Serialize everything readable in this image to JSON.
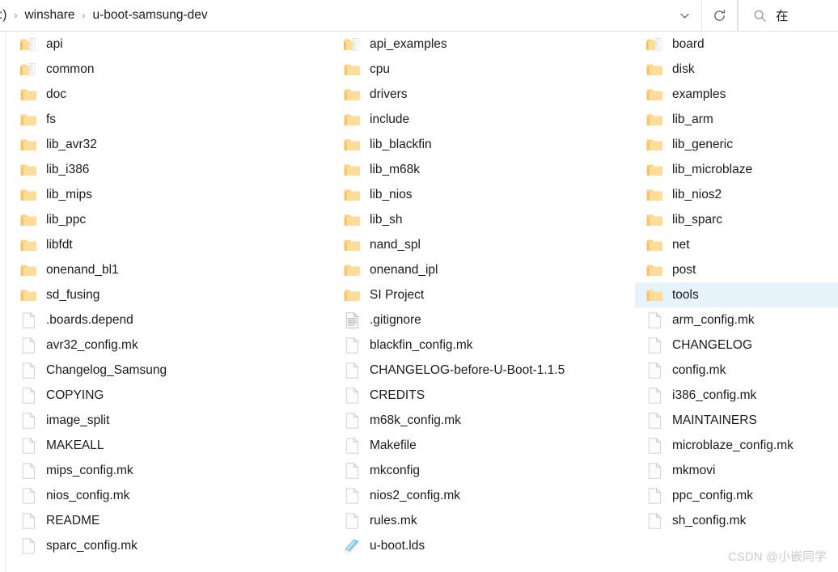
{
  "window": {
    "type": "file-explorer"
  },
  "addressbar": {
    "breadcrumbs": [
      {
        "label": ":)",
        "clipped": true
      },
      {
        "label": "winshare",
        "clipped": false
      },
      {
        "label": "u-boot-samsung-dev",
        "clipped": false
      }
    ],
    "separator": "›",
    "dropdown_icon": "chevron-down-icon",
    "refresh_icon": "refresh-icon",
    "search": {
      "icon": "search-icon",
      "placeholder": "在"
    }
  },
  "columns": [
    {
      "name": "column-1",
      "items": [
        {
          "name": "api",
          "icon": "shared-folder-icon"
        },
        {
          "name": "common",
          "icon": "shared-folder-icon"
        },
        {
          "name": "doc",
          "icon": "folder-icon"
        },
        {
          "name": "fs",
          "icon": "folder-icon"
        },
        {
          "name": "lib_avr32",
          "icon": "folder-icon"
        },
        {
          "name": "lib_i386",
          "icon": "folder-icon"
        },
        {
          "name": "lib_mips",
          "icon": "folder-icon"
        },
        {
          "name": "lib_ppc",
          "icon": "folder-icon"
        },
        {
          "name": "libfdt",
          "icon": "folder-icon"
        },
        {
          "name": "onenand_bl1",
          "icon": "folder-icon"
        },
        {
          "name": "sd_fusing",
          "icon": "folder-icon"
        },
        {
          "name": ".boards.depend",
          "icon": "file-icon"
        },
        {
          "name": "avr32_config.mk",
          "icon": "file-icon"
        },
        {
          "name": "Changelog_Samsung",
          "icon": "file-icon"
        },
        {
          "name": "COPYING",
          "icon": "file-icon"
        },
        {
          "name": "image_split",
          "icon": "file-icon"
        },
        {
          "name": "MAKEALL",
          "icon": "file-icon"
        },
        {
          "name": "mips_config.mk",
          "icon": "file-icon"
        },
        {
          "name": "nios_config.mk",
          "icon": "file-icon"
        },
        {
          "name": "README",
          "icon": "file-icon"
        },
        {
          "name": "sparc_config.mk",
          "icon": "file-icon"
        }
      ]
    },
    {
      "name": "column-2",
      "items": [
        {
          "name": "api_examples",
          "icon": "shared-folder-icon"
        },
        {
          "name": "cpu",
          "icon": "folder-icon"
        },
        {
          "name": "drivers",
          "icon": "folder-icon"
        },
        {
          "name": "include",
          "icon": "folder-icon"
        },
        {
          "name": "lib_blackfin",
          "icon": "folder-icon"
        },
        {
          "name": "lib_m68k",
          "icon": "folder-icon"
        },
        {
          "name": "lib_nios",
          "icon": "folder-icon"
        },
        {
          "name": "lib_sh",
          "icon": "folder-icon"
        },
        {
          "name": "nand_spl",
          "icon": "folder-icon"
        },
        {
          "name": "onenand_ipl",
          "icon": "folder-icon"
        },
        {
          "name": "SI Project",
          "icon": "folder-icon"
        },
        {
          "name": ".gitignore",
          "icon": "text-document-icon"
        },
        {
          "name": "blackfin_config.mk",
          "icon": "file-icon"
        },
        {
          "name": "CHANGELOG-before-U-Boot-1.1.5",
          "icon": "file-icon"
        },
        {
          "name": "CREDITS",
          "icon": "file-icon"
        },
        {
          "name": "m68k_config.mk",
          "icon": "file-icon"
        },
        {
          "name": "Makefile",
          "icon": "file-icon"
        },
        {
          "name": "mkconfig",
          "icon": "file-icon"
        },
        {
          "name": "nios2_config.mk",
          "icon": "file-icon"
        },
        {
          "name": "rules.mk",
          "icon": "file-icon"
        },
        {
          "name": "u-boot.lds",
          "icon": "lds-document-icon"
        }
      ]
    },
    {
      "name": "column-3",
      "items": [
        {
          "name": "board",
          "icon": "shared-folder-icon"
        },
        {
          "name": "disk",
          "icon": "folder-icon"
        },
        {
          "name": "examples",
          "icon": "folder-icon"
        },
        {
          "name": "lib_arm",
          "icon": "folder-icon"
        },
        {
          "name": "lib_generic",
          "icon": "folder-icon"
        },
        {
          "name": "lib_microblaze",
          "icon": "folder-icon"
        },
        {
          "name": "lib_nios2",
          "icon": "folder-icon"
        },
        {
          "name": "lib_sparc",
          "icon": "folder-icon"
        },
        {
          "name": "net",
          "icon": "folder-icon"
        },
        {
          "name": "post",
          "icon": "folder-icon"
        },
        {
          "name": "tools",
          "icon": "folder-icon",
          "selected": true
        },
        {
          "name": "arm_config.mk",
          "icon": "file-icon"
        },
        {
          "name": "CHANGELOG",
          "icon": "file-icon"
        },
        {
          "name": "config.mk",
          "icon": "file-icon"
        },
        {
          "name": "i386_config.mk",
          "icon": "file-icon"
        },
        {
          "name": "MAINTAINERS",
          "icon": "file-icon"
        },
        {
          "name": "microblaze_config.mk",
          "icon": "file-icon"
        },
        {
          "name": "mkmovi",
          "icon": "file-icon"
        },
        {
          "name": "ppc_config.mk",
          "icon": "file-icon"
        },
        {
          "name": "sh_config.mk",
          "icon": "file-icon"
        }
      ]
    }
  ],
  "watermark": {
    "text": "CSDN @小嵌同学"
  },
  "colors": {
    "selection": "#e7f3fb",
    "folder": "#ffd079",
    "folder_light": "#ffe4a8",
    "text": "#1b1b1b",
    "border": "#e3e3e3",
    "watermark": "#c9c9c9"
  }
}
